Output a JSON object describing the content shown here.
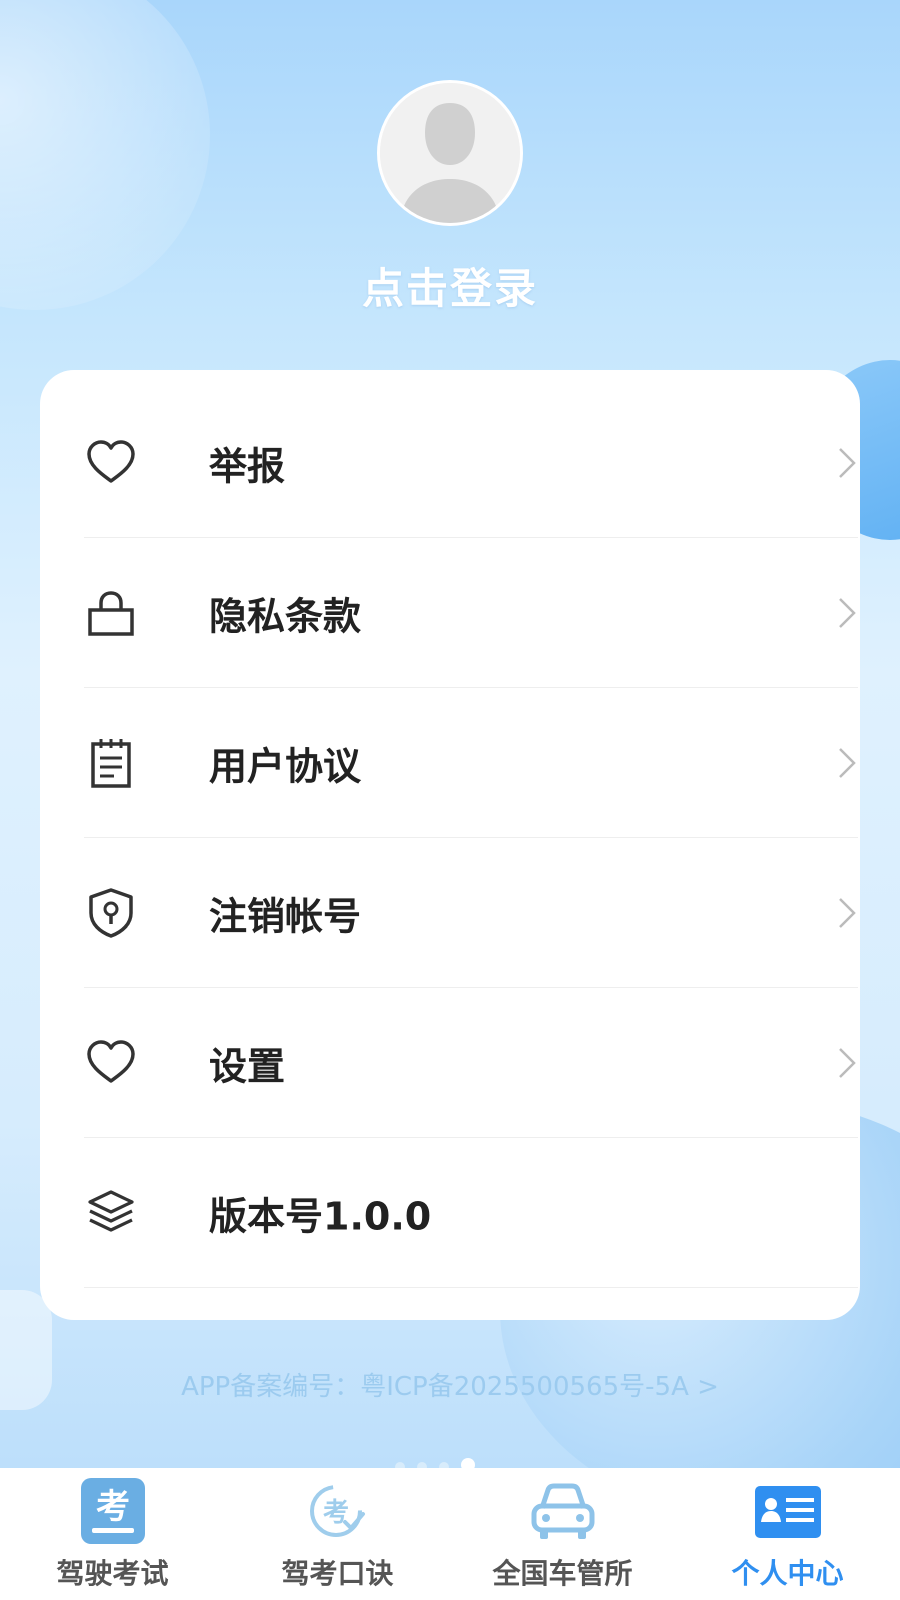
{
  "profile": {
    "login_label": "点击登录"
  },
  "menu": {
    "items": [
      {
        "id": "report",
        "label": "举报",
        "icon": "heart-icon",
        "has_arrow": true
      },
      {
        "id": "privacy",
        "label": "隐私条款",
        "icon": "lock-icon",
        "has_arrow": true
      },
      {
        "id": "agreement",
        "label": "用户协议",
        "icon": "notepad-icon",
        "has_arrow": true
      },
      {
        "id": "delete-account",
        "label": "注销帐号",
        "icon": "shield-lock-icon",
        "has_arrow": true
      },
      {
        "id": "settings",
        "label": "设置",
        "icon": "heart-icon",
        "has_arrow": true
      },
      {
        "id": "version",
        "label": "版本号1.0.0",
        "icon": "layers-icon",
        "has_arrow": false
      }
    ]
  },
  "footer": {
    "icp": "APP备案编号：粤ICP备2025500565号-5A >"
  },
  "tabbar": {
    "tabs": [
      {
        "label": "驾驶考试",
        "icon": "exam-icon",
        "active": false
      },
      {
        "label": "驾考口诀",
        "icon": "formula-icon",
        "active": false
      },
      {
        "label": "全国车管所",
        "icon": "car-icon",
        "active": false
      },
      {
        "label": "个人中心",
        "icon": "id-card-icon",
        "active": true
      }
    ]
  },
  "colors": {
    "accent": "#2f8ff0",
    "background": "#c5e6fd",
    "card": "#ffffff",
    "text": "#222222"
  }
}
